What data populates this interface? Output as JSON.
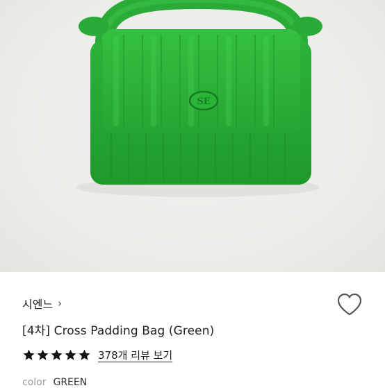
{
  "product": {
    "image_alt": "Green quilted padded cross bag",
    "brand": "시엔느",
    "brand_chevron": "›",
    "title": "[4차] Cross Padding Bag (Green)",
    "rating_stars": 5,
    "reviews_label": "378개 리뷰 보기",
    "color_label": "color",
    "color_value": "GREEN",
    "logo_text": "SE"
  },
  "colors": {
    "bag_green": "#2fb33a",
    "star": "#111111",
    "heart_outline": "#555555"
  }
}
